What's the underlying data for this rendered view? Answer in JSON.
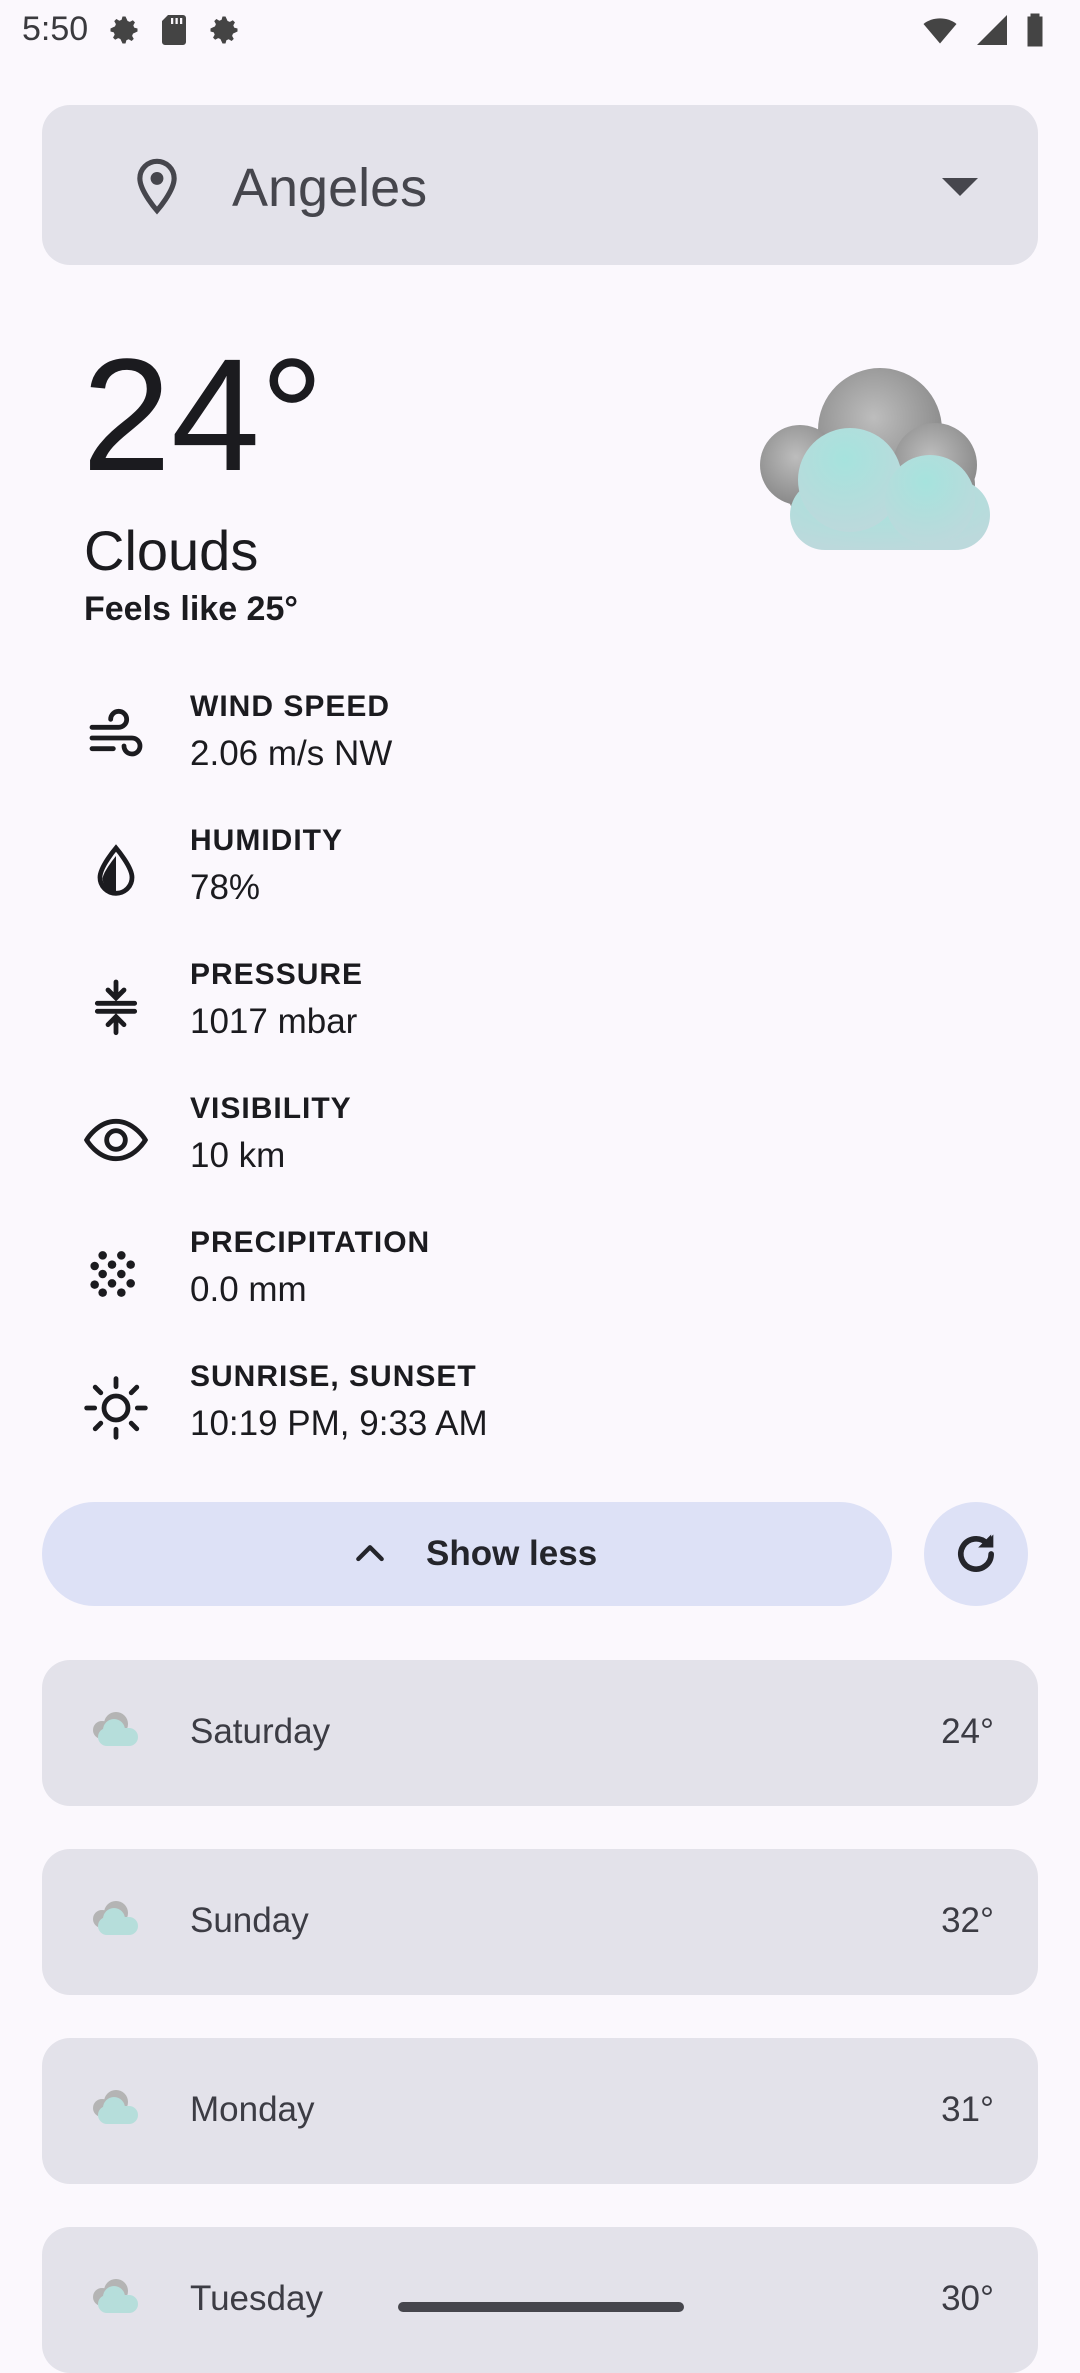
{
  "status_bar": {
    "time": "5:50",
    "left_icons": [
      "settings-gear-icon",
      "sd-card-icon",
      "settings-gear-icon"
    ],
    "right_icons": [
      "wifi-icon",
      "signal-icon",
      "battery-icon"
    ]
  },
  "location": {
    "name": "Angeles"
  },
  "current": {
    "temperature": "24°",
    "condition": "Clouds",
    "feels_like": "Feels like 25°"
  },
  "details": [
    {
      "icon": "wind-icon",
      "title": "WIND SPEED",
      "value": "2.06 m/s NW"
    },
    {
      "icon": "humidity-drop-icon",
      "title": "HUMIDITY",
      "value": "78%"
    },
    {
      "icon": "pressure-icon",
      "title": "PRESSURE",
      "value": "1017 mbar"
    },
    {
      "icon": "visibility-eye-icon",
      "title": "VISIBILITY",
      "value": "10 km"
    },
    {
      "icon": "precipitation-icon",
      "title": "PRECIPITATION",
      "value": "0.0 mm"
    },
    {
      "icon": "sun-icon",
      "title": "SUNRISE, SUNSET",
      "value": "10:19 PM, 9:33 AM"
    }
  ],
  "actions": {
    "toggle_label": "Show less",
    "refresh_icon": "refresh-icon"
  },
  "forecast": [
    {
      "day": "Saturday",
      "temp": "24°"
    },
    {
      "day": "Sunday",
      "temp": "32°"
    },
    {
      "day": "Monday",
      "temp": "31°"
    },
    {
      "day": "Tuesday",
      "temp": "30°"
    }
  ]
}
